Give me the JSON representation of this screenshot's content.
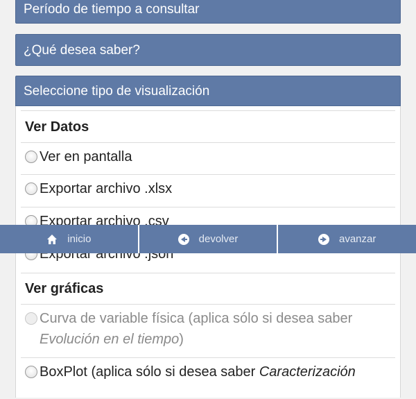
{
  "sections": {
    "periodo": "Período de tiempo a consultar",
    "saber": "¿Qué desea saber?",
    "tipo": "Seleccione tipo de visualización"
  },
  "ver_datos": {
    "label": "Ver Datos",
    "options": [
      "Ver en pantalla",
      "Exportar archivo .xlsx",
      "Exportar archivo .csv",
      "Exportar archivo .json"
    ]
  },
  "ver_graficas": {
    "label": "Ver gráficas",
    "curva": {
      "text": "Curva de variable física (aplica sólo si desea saber ",
      "italic": "Evolución en el tiempo",
      "close": ")"
    },
    "boxplot": {
      "text": "BoxPlot (aplica sólo si desea saber ",
      "italic": "Caracterización"
    }
  },
  "navbar": {
    "inicio": "inicio",
    "devolver": "devolver",
    "avanzar": "avanzar"
  },
  "colors": {
    "header": "#5f7aa6",
    "background": "#f1f1f1"
  }
}
